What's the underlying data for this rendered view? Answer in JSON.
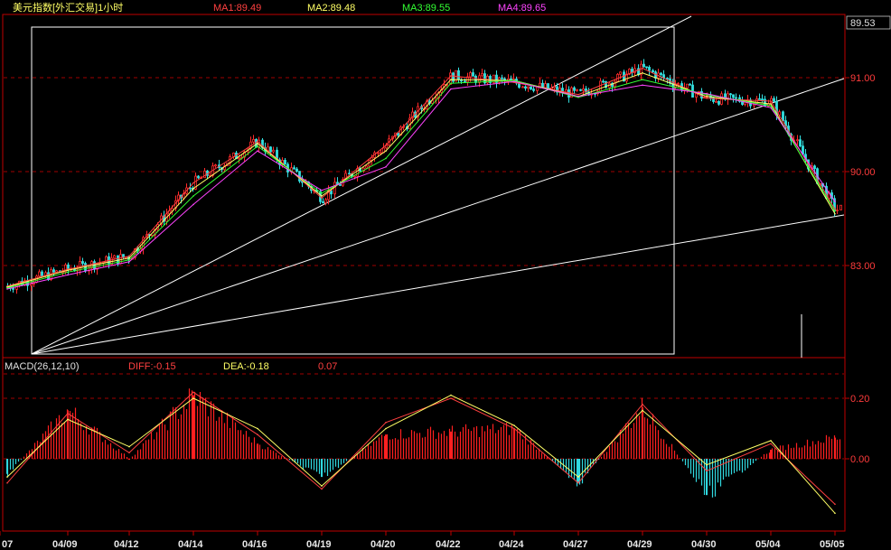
{
  "window": {
    "title": "美元指数[外汇交易]1小时"
  },
  "price_panel": {
    "ma_labels": [
      {
        "text": "MA1:89.49",
        "color": "#ff4040"
      },
      {
        "text": "MA2:89.48",
        "color": "#ffff66"
      },
      {
        "text": "MA3:89.55",
        "color": "#33ff33"
      },
      {
        "text": "MA4:89.65",
        "color": "#ff44ff"
      }
    ],
    "current_price": "89.53"
  },
  "macd_panel": {
    "title": "MACD(26,12,10)",
    "diff_label": "DIFF:-0.15",
    "dea_label": "DEA:-0.18",
    "macd_value": "0.07"
  },
  "chart_data": [
    {
      "type": "line",
      "panel": "price",
      "title": "美元指数[外汇交易]1小时",
      "y_ticks": [
        "91.00",
        "90.00",
        "83.00"
      ],
      "ylim": [
        88.6,
        91.5
      ],
      "x_ticks": [
        "07",
        "04/09",
        "04/12",
        "04/14",
        "04/16",
        "04/19",
        "04/20",
        "04/22",
        "04/24",
        "04/27",
        "04/29",
        "04/30",
        "05/04",
        "05/05"
      ],
      "x": [
        "07",
        "04/09",
        "04/12",
        "04/14",
        "04/16",
        "04/19",
        "04/20",
        "04/22",
        "04/24",
        "04/27",
        "04/29",
        "04/30",
        "05/04",
        "05/05"
      ],
      "series": [
        {
          "name": "MA1",
          "values": [
            88.78,
            88.96,
            89.1,
            89.88,
            90.32,
            89.72,
            90.28,
            91.02,
            90.95,
            90.82,
            91.1,
            90.78,
            90.75,
            89.6
          ]
        },
        {
          "name": "MA2",
          "values": [
            88.77,
            88.95,
            89.08,
            89.82,
            90.3,
            89.74,
            90.22,
            90.98,
            90.97,
            90.8,
            91.05,
            90.8,
            90.72,
            89.55
          ]
        },
        {
          "name": "MA3",
          "values": [
            88.76,
            88.93,
            89.06,
            89.74,
            90.27,
            89.77,
            90.14,
            90.94,
            90.97,
            90.79,
            90.98,
            90.82,
            90.7,
            89.58
          ]
        },
        {
          "name": "MA4",
          "values": [
            88.75,
            88.9,
            89.04,
            89.65,
            90.22,
            89.8,
            90.05,
            90.88,
            90.96,
            90.8,
            90.92,
            90.83,
            90.68,
            89.68
          ]
        }
      ]
    },
    {
      "type": "bar",
      "panel": "macd",
      "title": "MACD(26,12,10)",
      "y_ticks": [
        "0.20",
        "0.00"
      ],
      "ylim": [
        -0.45,
        0.35
      ],
      "categories": [
        "07",
        "04/09",
        "04/12",
        "04/14",
        "04/16",
        "04/19",
        "04/20",
        "04/22",
        "04/24",
        "04/27",
        "04/29",
        "04/30",
        "05/04",
        "05/05"
      ],
      "series": [
        {
          "name": "MACD",
          "values": [
            -0.05,
            0.16,
            0.0,
            0.21,
            0.05,
            -0.06,
            0.08,
            0.09,
            0.1,
            -0.08,
            0.17,
            -0.12,
            0.03,
            0.07
          ]
        },
        {
          "name": "DIFF",
          "values": [
            -0.08,
            0.15,
            0.02,
            0.22,
            0.08,
            -0.1,
            0.12,
            0.2,
            0.1,
            -0.08,
            0.18,
            -0.04,
            0.05,
            -0.15
          ]
        },
        {
          "name": "DEA",
          "values": [
            -0.06,
            0.13,
            0.04,
            0.2,
            0.1,
            -0.09,
            0.1,
            0.21,
            0.11,
            -0.06,
            0.16,
            -0.02,
            0.06,
            -0.18
          ]
        }
      ]
    }
  ]
}
